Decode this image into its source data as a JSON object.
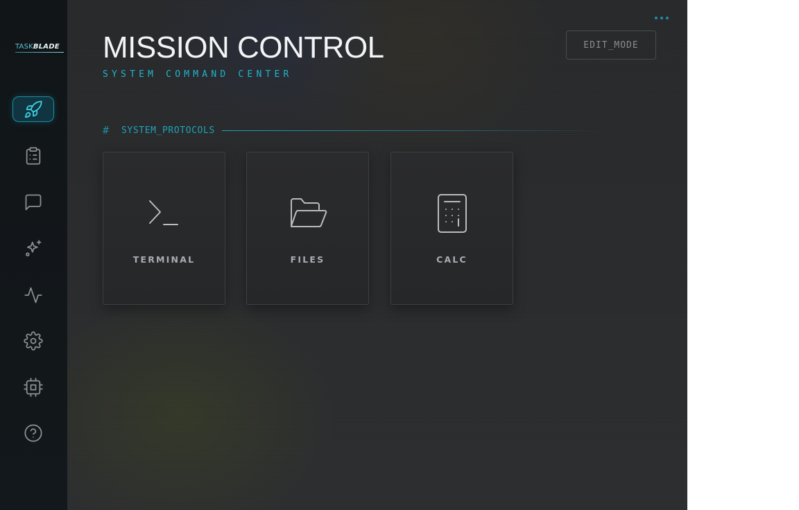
{
  "brand": {
    "part1": "TASK",
    "part2": "BLADE"
  },
  "sidebar": {
    "items": [
      {
        "icon": "rocket-icon",
        "active": true
      },
      {
        "icon": "clipboard-icon",
        "active": false
      },
      {
        "icon": "chat-icon",
        "active": false
      },
      {
        "icon": "sparkles-icon",
        "active": false
      },
      {
        "icon": "activity-icon",
        "active": false
      },
      {
        "icon": "gear-icon",
        "active": false
      },
      {
        "icon": "chip-icon",
        "active": false
      },
      {
        "icon": "help-icon",
        "active": false
      }
    ]
  },
  "header": {
    "title": "MISSION CONTROL",
    "subtitle": "SYSTEM COMMAND CENTER",
    "edit_button": "EDIT_MODE",
    "more_icon": "more-dots-icon"
  },
  "section": {
    "hash": "#",
    "title": "SYSTEM_PROTOCOLS"
  },
  "tiles": [
    {
      "label": "TERMINAL",
      "icon": "terminal-icon"
    },
    {
      "label": "FILES",
      "icon": "folder-icon"
    },
    {
      "label": "CALC",
      "icon": "calculator-icon"
    }
  ],
  "colors": {
    "accent": "#1fb6cc",
    "background": "#2c2d2f",
    "sidebar": "#12171a",
    "title": "#f2f4f5",
    "tile_label": "#a9adb2",
    "icon_muted": "#8e9296"
  }
}
